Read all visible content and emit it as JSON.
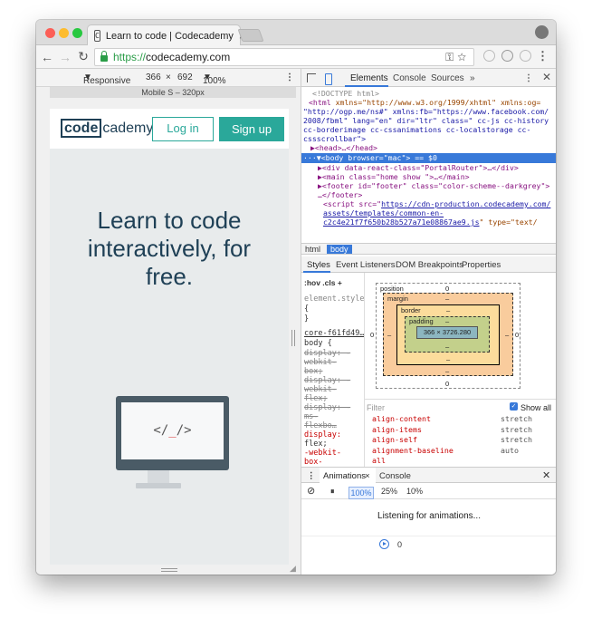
{
  "browser": {
    "tab_title": "Learn to code | Codecademy",
    "url_scheme": "https://",
    "url_host": "codecademy.com"
  },
  "device_toolbar": {
    "mode": "Responsive",
    "width": "366",
    "separator": "×",
    "height": "692",
    "zoom": "100%",
    "device_label": "Mobile S – 320px"
  },
  "page": {
    "logo_boxed": "code",
    "logo_rest": "cademy",
    "login_label": "Log in",
    "signup_label": "Sign up",
    "hero_lines": [
      "Learn to code",
      "interactively, for",
      "free."
    ],
    "screen_code_left": "</",
    "screen_code_under": "_",
    "screen_code_right": "/>"
  },
  "devtools": {
    "tabs": [
      "Elements",
      "Console",
      "Sources",
      "»"
    ],
    "dom": {
      "l1": "<!DOCTYPE html>",
      "l2_tag": "<html",
      "l2_attrs": " xmlns=\"http://www.w3.org/1999/xhtml\" xmlns:og=",
      "l3": "\"http://ogp.me/ns#\" xmlns:fb=\"https://www.facebook.com/",
      "l4": "2008/fbml\" lang=\"en\" dir=\"ltr\" class=\" cc-js cc-history",
      "l5": "cc-borderimage cc-cssanimations cc-localstorage cc-",
      "l6": "cssscrollbar\">",
      "l7": "▶<head>…</head>",
      "l8": "···▼<body browser=\"mac\"> == $0",
      "l9": "▶<div data-react-class=\"PortalRouter\">…</div>",
      "l10": "▶<main class=\"home show \">…</main>",
      "l11": "▶<footer id=\"footer\" class=\"color-scheme--darkgrey\">",
      "l12": "…</footer>",
      "l13_tag": "<script src=\"",
      "l13_link": "https://cdn-production.codecademy.com/",
      "l14_link": "assets/templates/common-en-",
      "l15_link": "c2c4e21f7f650b28b527a71e08867ae9.js",
      "l15_rest": "\" type=\"text/"
    },
    "crumbs": [
      "html",
      "body"
    ],
    "subtabs": [
      "Styles",
      "Event Listeners",
      "DOM Breakpoints",
      "Properties"
    ],
    "styles_filter": ":hov  .cls  +",
    "styles_lines": [
      "element.style",
      "{",
      "}",
      "core-f61fd49…",
      "body {",
      "  display: -",
      "    webkit-",
      "    box;",
      "  display: -",
      "    webkit-",
      "    flex;",
      "  display: -",
      "    ms-",
      "    flexbo…",
      "  display:",
      "    flex;",
      "  -webkit-",
      "    box-",
      "    orient:",
      "    vertic…"
    ],
    "box_model": {
      "position_label": "position",
      "position_val": "0",
      "margin_label": "margin",
      "margin_val": "–",
      "border_label": "border",
      "border_val": "–",
      "padding_label": "padding",
      "padding_val": "–",
      "content": "366 × 3726.280",
      "left": "0",
      "right": "0",
      "bottom": "0",
      "dash": "–"
    },
    "computed_filter": "Filter",
    "show_all": "Show all",
    "computed": [
      {
        "k": "align-content",
        "v": "stretch"
      },
      {
        "k": "align-items",
        "v": "stretch"
      },
      {
        "k": "align-self",
        "v": "stretch"
      },
      {
        "k": "alignment-baseline",
        "v": "auto"
      },
      {
        "k": "all",
        "v": ""
      }
    ],
    "drawer_tabs": [
      "Animations",
      "Console"
    ],
    "speeds": [
      "100%",
      "25%",
      "10%"
    ],
    "listening": "Listening for animations...",
    "timeline_zero": "0"
  }
}
